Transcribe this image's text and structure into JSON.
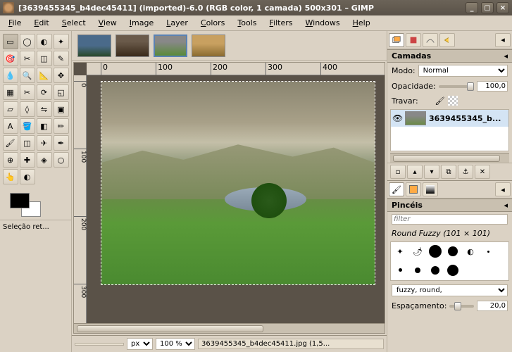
{
  "title": "[3639455345_b4dec45411] (imported)-6.0 (RGB color, 1 camada) 500x301 – GIMP",
  "menu": [
    "File",
    "Edit",
    "Select",
    "View",
    "Image",
    "Layer",
    "Colors",
    "Tools",
    "Filters",
    "Windows",
    "Help"
  ],
  "sel_label": "Seleção ret...",
  "ruler_h": [
    "0",
    "100",
    "200",
    "300",
    "400"
  ],
  "ruler_v": [
    "0",
    "100",
    "200",
    "300"
  ],
  "status": {
    "unit": "px",
    "zoom": "100 %",
    "file": "3639455345_b4dec45411.jpg (1,5..."
  },
  "layers": {
    "title": "Camadas",
    "mode_l": "Modo:",
    "mode_v": "Normal",
    "opac_l": "Opacidade:",
    "opac_v": "100,0",
    "lock_l": "Travar:",
    "layer_name": "3639455345_b..."
  },
  "brushes": {
    "title": "Pincéis",
    "filter_ph": "filter",
    "label": "Round Fuzzy (101 × 101)",
    "preset": "fuzzy, round,",
    "spacing_l": "Espaçamento:",
    "spacing_v": "20,0"
  }
}
